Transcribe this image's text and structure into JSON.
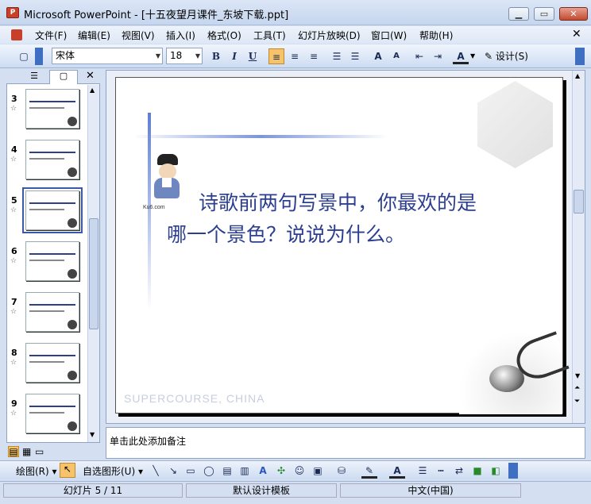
{
  "window": {
    "title": "Microsoft PowerPoint - [十五夜望月课件_东坡下载.ppt]",
    "app_icon": "powerpoint-icon"
  },
  "menu": [
    "文件(F)",
    "编辑(E)",
    "视图(V)",
    "插入(I)",
    "格式(O)",
    "工具(T)",
    "幻灯片放映(D)",
    "窗口(W)",
    "帮助(H)"
  ],
  "toolbar": {
    "font_name": "宋体",
    "font_size": "18",
    "bold": "B",
    "italic": "I",
    "underline": "U",
    "design_label": "设计(S)"
  },
  "thumbnails": [
    {
      "num": "3"
    },
    {
      "num": "4"
    },
    {
      "num": "5"
    },
    {
      "num": "6"
    },
    {
      "num": "7"
    },
    {
      "num": "8"
    },
    {
      "num": "9"
    }
  ],
  "selected_slide": "5",
  "slide": {
    "text": "诗歌前两句写景中，你最欢的是哪一个景色？说说为什么。",
    "text_line1": "诗歌前两句写景中，你最欢的是",
    "text_line2": "哪一个景色？说说为什么。",
    "watermark": "SUPERCOURSE, CHINA",
    "logo_text": "Ku6.com"
  },
  "notes_placeholder": "单击此处添加备注",
  "drawbar": {
    "draw_label": "绘图(R)",
    "autoshapes_label": "自选图形(U)"
  },
  "status": {
    "slide": "幻灯片 5 / 11",
    "template": "默认设计模板",
    "language": "中文(中国)"
  },
  "colors": {
    "accent": "#2c3f8f",
    "title_text": "#2c3f8f"
  }
}
